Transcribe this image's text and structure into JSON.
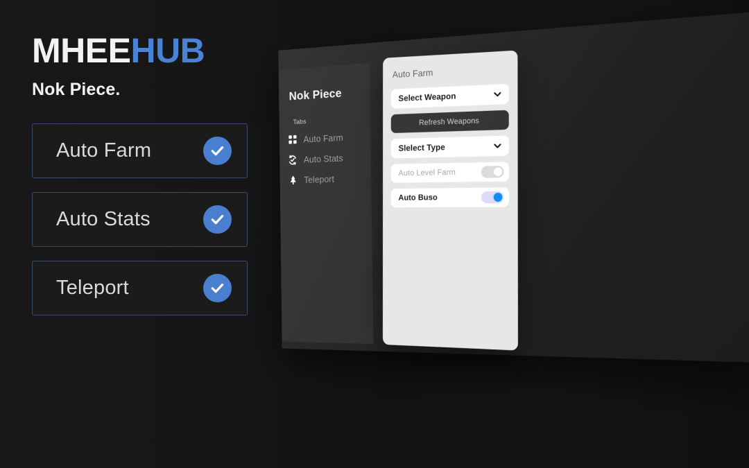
{
  "brand": {
    "logo_primary": "MHEE",
    "logo_accent": "HUB",
    "tagline": "Nok Piece.",
    "accent_color": "#4a82d6"
  },
  "features": {
    "cards": [
      {
        "label": "Auto Farm",
        "status_icon": "check-circle-icon",
        "enabled": true
      },
      {
        "label": "Auto Stats",
        "status_icon": "check-circle-icon",
        "enabled": true
      },
      {
        "label": "Teleport",
        "status_icon": "check-circle-icon",
        "enabled": true
      }
    ],
    "badge_color": "#4a7fd0"
  },
  "gui": {
    "title": "Nok Piece",
    "tabs_label": "Tabs",
    "tabs": [
      {
        "label": "Auto Farm",
        "icon": "grid-icon"
      },
      {
        "label": "Auto Stats",
        "icon": "refresh-check-icon"
      },
      {
        "label": "Teleport",
        "icon": "pine-tree-icon"
      }
    ],
    "panel": {
      "heading": "Auto Farm",
      "weapon_select": {
        "value": "Select Weapon",
        "icon": "chevron-down-icon"
      },
      "refresh_button": "Refresh Weapons",
      "type_select": {
        "value": "Slelect Type",
        "icon": "chevron-down-icon"
      },
      "toggles": [
        {
          "label": "Auto Level Farm",
          "state": "off"
        },
        {
          "label": "Auto Buso",
          "state": "on"
        }
      ]
    }
  }
}
